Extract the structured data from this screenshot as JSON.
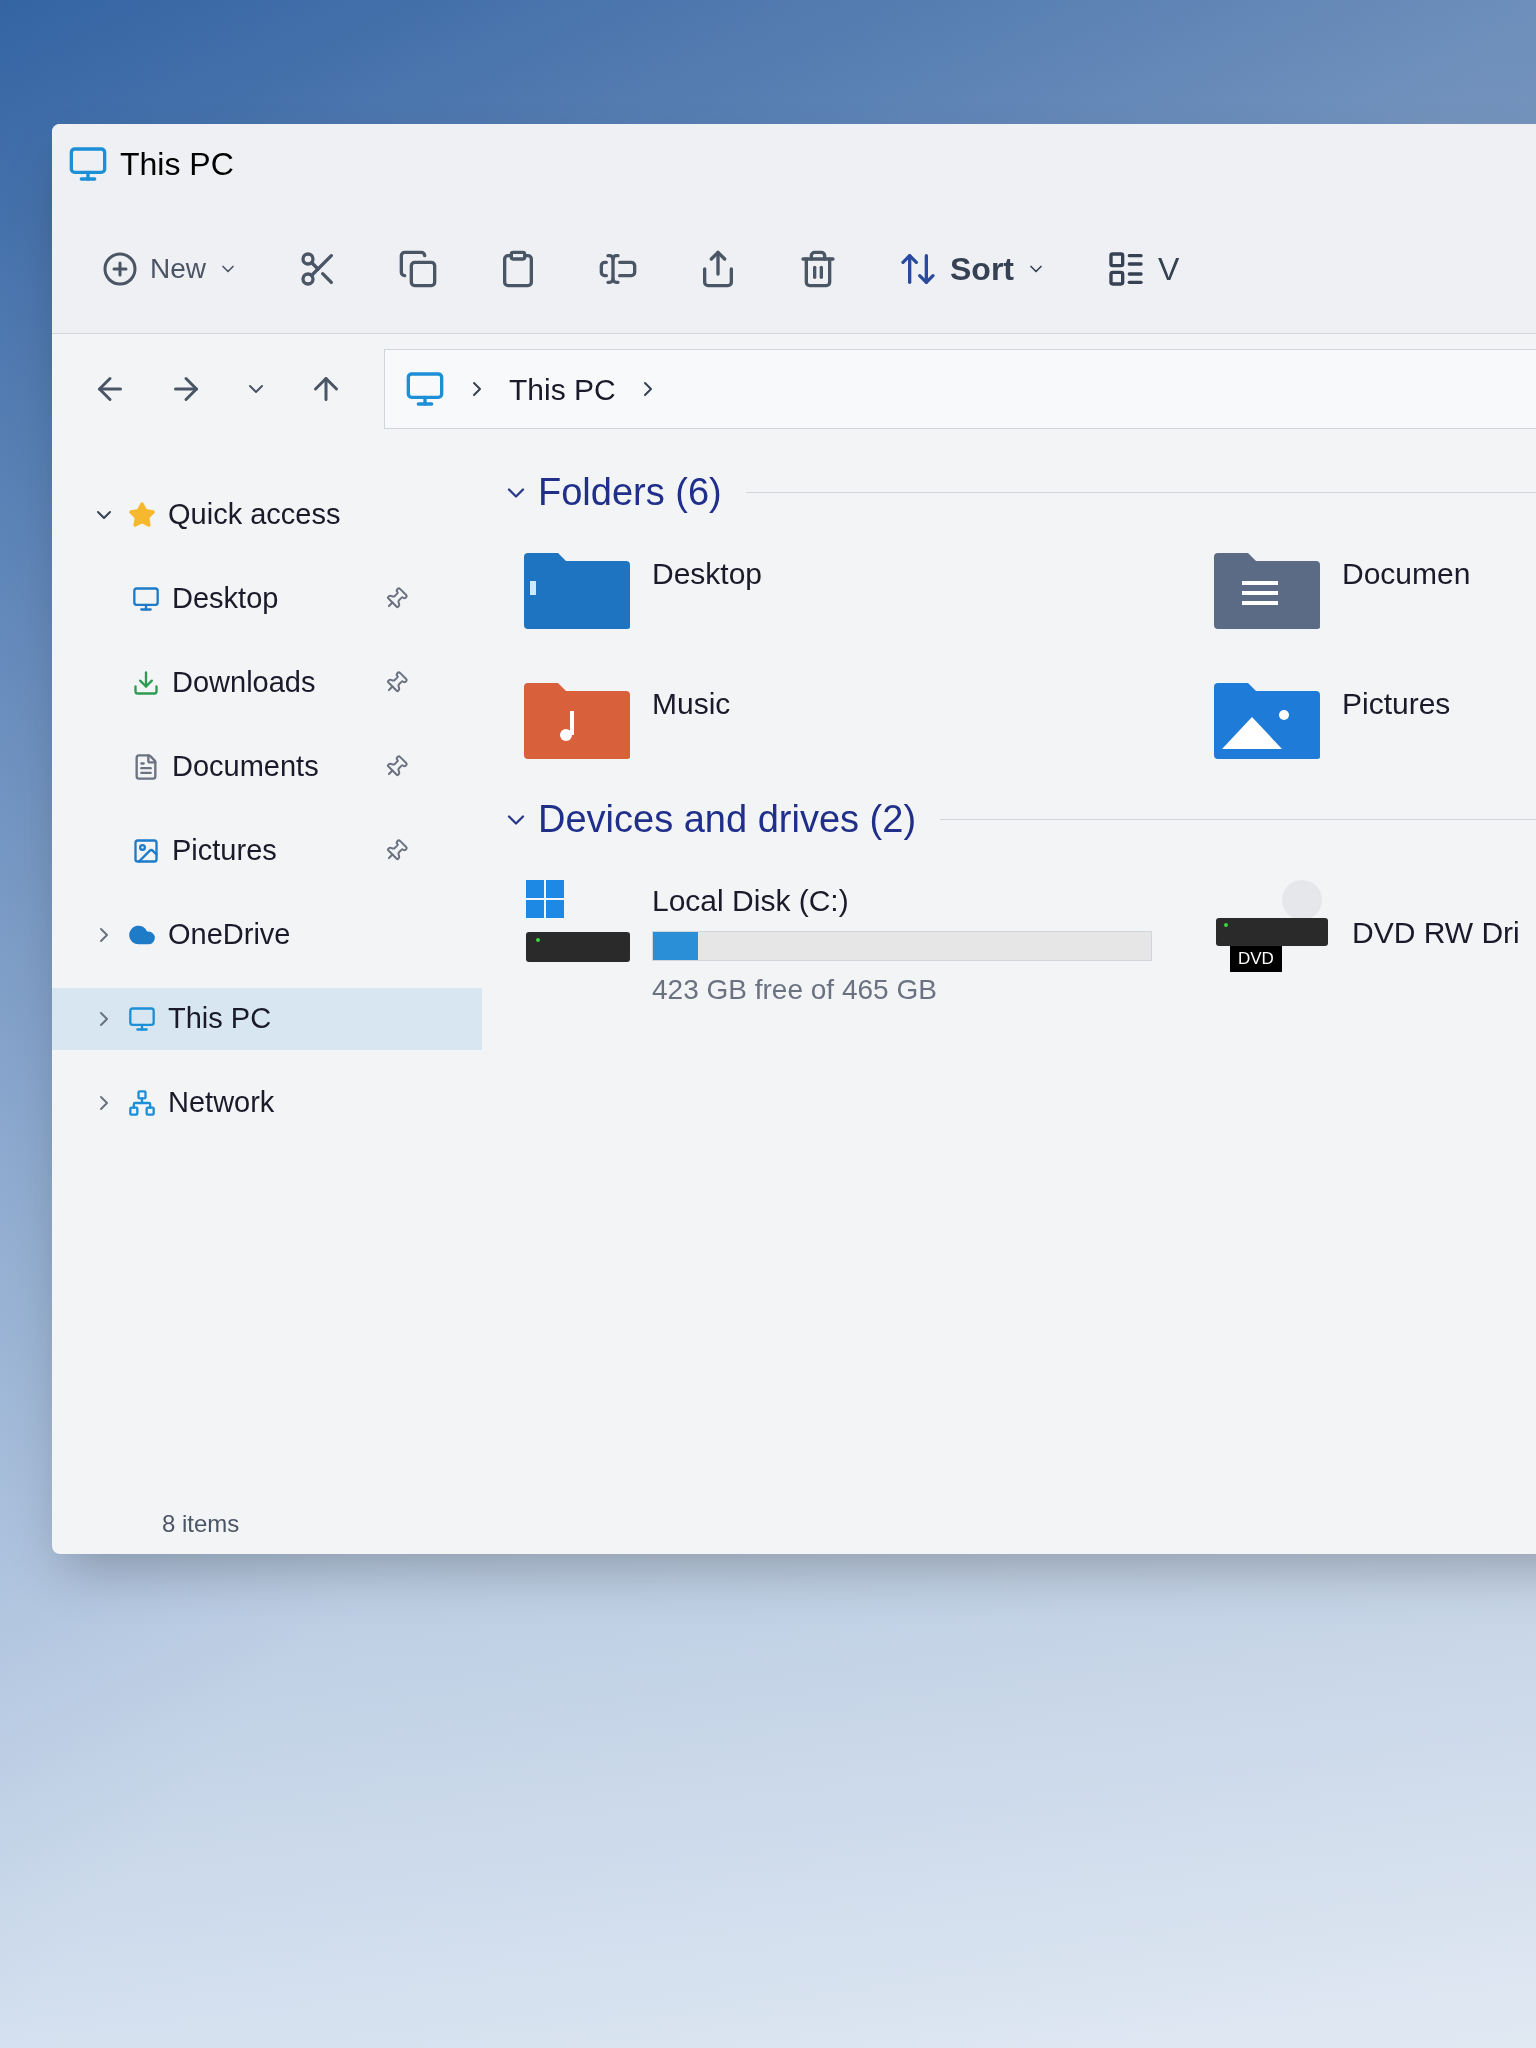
{
  "window": {
    "title": "This PC"
  },
  "toolbar": {
    "new_label": "New",
    "sort_label": "Sort",
    "view_label": "V"
  },
  "address_bar": {
    "path": [
      "This PC"
    ]
  },
  "sidebar": {
    "items": [
      {
        "label": "Quick access",
        "kind": "star",
        "expanded": true,
        "selected": false,
        "children": [
          {
            "label": "Desktop",
            "kind": "desktop",
            "pinned": true,
            "selected": false
          },
          {
            "label": "Downloads",
            "kind": "downloads",
            "pinned": true,
            "selected": false
          },
          {
            "label": "Documents",
            "kind": "documents",
            "pinned": true,
            "selected": false
          },
          {
            "label": "Pictures",
            "kind": "pictures",
            "pinned": true,
            "selected": false
          }
        ]
      },
      {
        "label": "OneDrive",
        "kind": "cloud",
        "expanded": false,
        "selected": false
      },
      {
        "label": "This PC",
        "kind": "pc",
        "expanded": false,
        "selected": true
      },
      {
        "label": "Network",
        "kind": "network",
        "expanded": false,
        "selected": false
      }
    ]
  },
  "folders": {
    "heading": "Folders (6)",
    "expanded": true,
    "items": [
      {
        "label": "Desktop",
        "kind": "desktop"
      },
      {
        "label": "Documen",
        "kind": "documents"
      },
      {
        "label": "Music",
        "kind": "music"
      },
      {
        "label": "Pictures",
        "kind": "pictures"
      }
    ]
  },
  "drives": {
    "heading": "Devices and drives (2)",
    "expanded": true,
    "items": [
      {
        "label": "Local Disk (C:)",
        "kind": "disk",
        "level": 0.09,
        "free_text": "423 GB free of 465 GB"
      },
      {
        "label": "DVD RW Dri",
        "kind": "optical",
        "badge": "DVD"
      }
    ]
  },
  "status_bar": {
    "count": "8 items"
  }
}
